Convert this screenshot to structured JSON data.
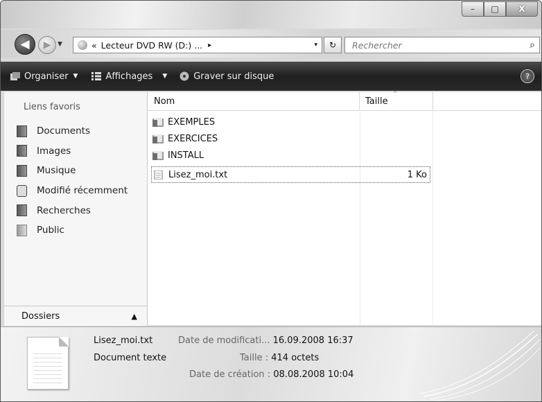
{
  "window": {
    "controls": {
      "minimize": "–",
      "maximize": "□",
      "close": "X"
    }
  },
  "nav": {
    "back_icon": "back-arrow-icon",
    "forward_icon": "forward-arrow-icon",
    "address": {
      "prefix": "«",
      "path": "Lecteur DVD RW (D:) ...",
      "separator": "▸",
      "dropdown": "▾"
    },
    "refresh_glyph": "↻",
    "search": {
      "placeholder": "Rechercher"
    }
  },
  "toolbar": {
    "organize": "Organiser",
    "views": "Affichages",
    "burn": "Graver sur disque",
    "help": "?"
  },
  "sidebar": {
    "header": "Liens favoris",
    "items": [
      {
        "label": "Documents"
      },
      {
        "label": "Images"
      },
      {
        "label": "Musique"
      },
      {
        "label": "Modifié récemment"
      },
      {
        "label": "Recherches"
      },
      {
        "label": "Public"
      }
    ],
    "folders": "Dossiers"
  },
  "files": {
    "columns": {
      "name": "Nom",
      "size": "Taille"
    },
    "rows": [
      {
        "name": "EXEMPLES",
        "type": "folder",
        "size": ""
      },
      {
        "name": "EXERCICES",
        "type": "folder",
        "size": ""
      },
      {
        "name": "INSTALL",
        "type": "folder",
        "size": ""
      },
      {
        "name": "Lisez_moi.txt",
        "type": "file",
        "size": "1 Ko",
        "selected": true
      }
    ]
  },
  "details": {
    "name": "Lisez_moi.txt",
    "type": "Document texte",
    "modified_label": "Date de modificati...",
    "modified_value": "16.09.2008 16:37",
    "size_label": "Taille :",
    "size_value": "414 octets",
    "created_label": "Date de création :",
    "created_value": "08.08.2008 10:04"
  },
  "colors": {
    "toolbar_bg": "#2a2a2a",
    "toolbar_text": "#f0f0f0",
    "sidebar_bg": "#f6f6f6"
  }
}
